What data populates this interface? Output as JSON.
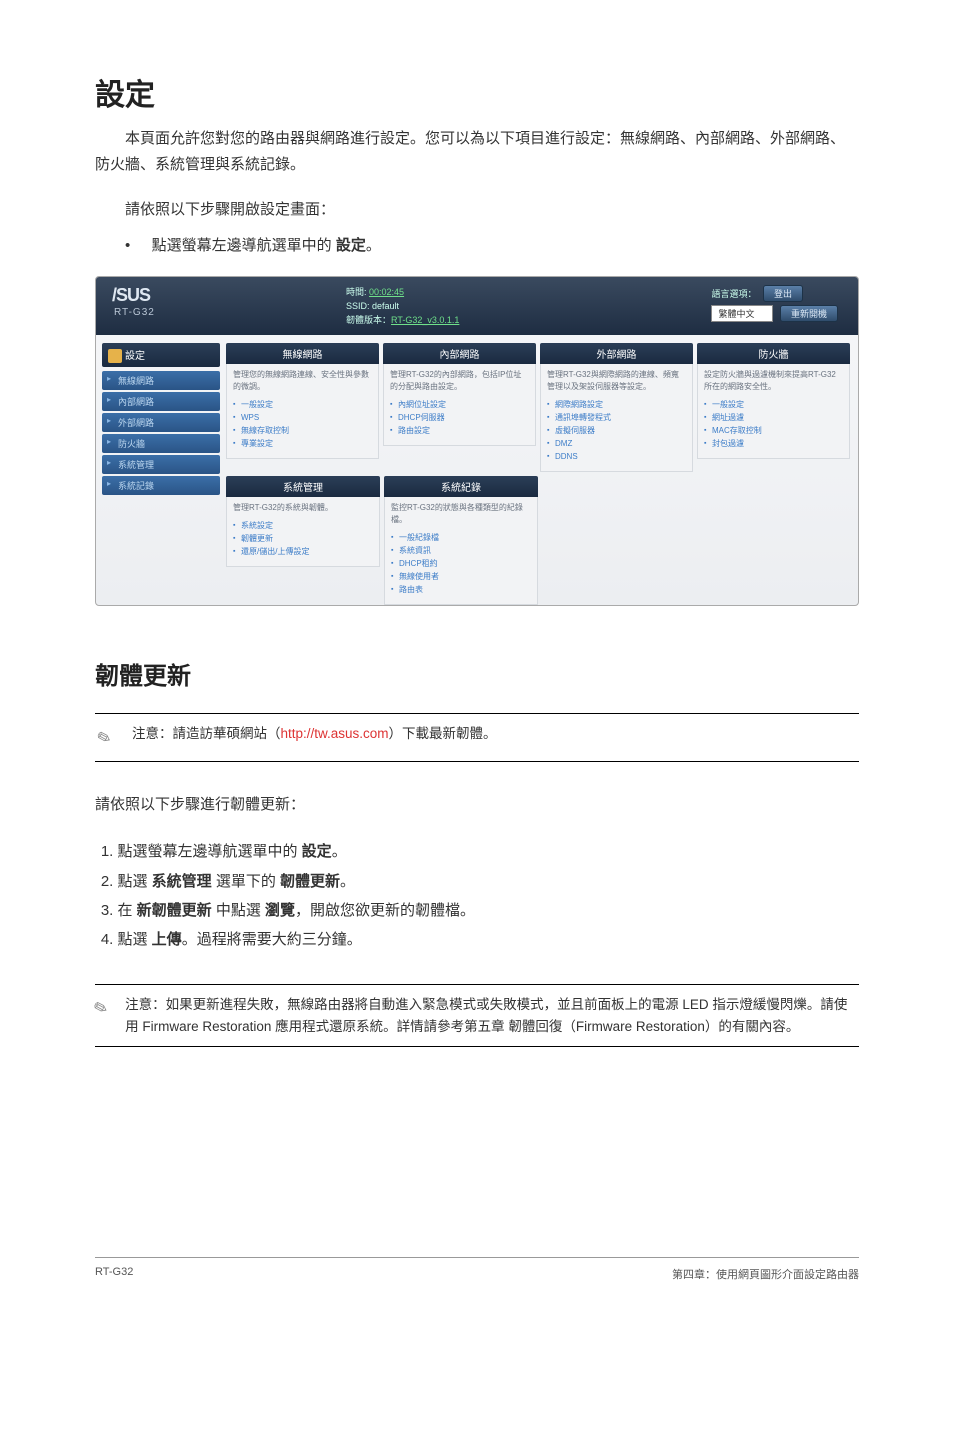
{
  "title": "設定",
  "desc_p1": "本頁面允許您對您的路由器與網路進行設定。您可以為以下項目進行設定：無線網路、內部網路、外部網路、防火牆、系統管理與系統記錄。",
  "steps_intro": "請依照以下步驟開啟設定畫面：",
  "bullet1_prefix": "點選螢幕左邊導航選單中的 ",
  "bullet1_bold": "設定",
  "bullet1_suffix": "。",
  "ss": {
    "logo": "/SUS",
    "model": "RT-G32",
    "time_label": "時間: ",
    "time_link": "00:02:45",
    "ssid_label": "SSID: default",
    "fw_label": "韌體版本：",
    "fw_link": "RT-G32_v3.0.1.1",
    "lang_label": "語言選項：",
    "lang_value": "繁體中文",
    "btn_logout": "登出",
    "btn_reboot": "重新開機",
    "side_hdr": "設定",
    "side_items": [
      "無線網路",
      "內部網路",
      "外部網路",
      "防火牆",
      "系統管理",
      "系統記錄"
    ],
    "cards_row1": [
      {
        "hdr": "無線網路",
        "sub": "管理您的無線網路連線、安全性與參數的微調。",
        "items": [
          "一般設定",
          "WPS",
          "無線存取控制",
          "專業設定"
        ]
      },
      {
        "hdr": "內部網路",
        "sub": "管理RT-G32的內部網路，包括IP位址的分配與路由設定。",
        "items": [
          "內網位址設定",
          "DHCP伺服器",
          "路由設定"
        ]
      },
      {
        "hdr": "外部網路",
        "sub": "管理RT-G32與網際網路的連線、頻寬管理以及架設伺服器等設定。",
        "items": [
          "網際網路設定",
          "通訊埠轉發程式",
          "虛擬伺服器",
          "DMZ",
          "DDNS"
        ]
      },
      {
        "hdr": "防火牆",
        "sub": "設定防火牆與過濾機制來提高RT-G32所在的網路安全性。",
        "items": [
          "一般設定",
          "網址過濾",
          "MAC存取控制",
          "封包過濾"
        ]
      }
    ],
    "cards_row2": [
      {
        "hdr": "系統管理",
        "sub": "管理RT-G32的系統與韌體。",
        "items": [
          "系統設定",
          "韌體更新",
          "還原/儲出/上傳設定"
        ]
      },
      {
        "hdr": "系統紀錄",
        "sub": "監控RT-G32的狀態與各種類型的紀錄檔。",
        "items": [
          "一般紀錄檔",
          "系統資訊",
          "DHCP租約",
          "無線使用者",
          "路由表"
        ]
      }
    ]
  },
  "h2": "韌體更新",
  "note1_prefix": "注意：請造訪華碩網站（",
  "note1_link": "http://tw.asus.com",
  "note1_suffix": "）下載最新韌體。",
  "steps2_intro": "請依照以下步驟進行韌體更新：",
  "steps2": [
    {
      "pre": "點選螢幕左邊導航選單中的 ",
      "b": "設定",
      "post": "。"
    },
    {
      "pre": "點選 ",
      "b": "系統管理",
      "mid": " 選單下的 ",
      "b2": "韌體更新",
      "post": "。"
    },
    {
      "pre": "在 ",
      "b": "新韌體更新",
      "mid": " 中點選 ",
      "b2": "瀏覽",
      "post": "，開啟您欲更新的韌體檔。"
    },
    {
      "pre": "點選 ",
      "b": "上傳",
      "post": "。過程將需要大約三分鐘。"
    }
  ],
  "note2": "注意：如果更新進程失敗，無線路由器將自動進入緊急模式或失敗模式，並且前面板上的電源 LED 指示燈緩慢閃爍。請使用 Firmware Restoration 應用程式還原系統。詳情請參考第五章 韌體回復（Firmware Restoration）的有關內容。",
  "footer_left": "RT-G32",
  "footer_right": "第四章：使用網頁圖形介面設定路由器"
}
